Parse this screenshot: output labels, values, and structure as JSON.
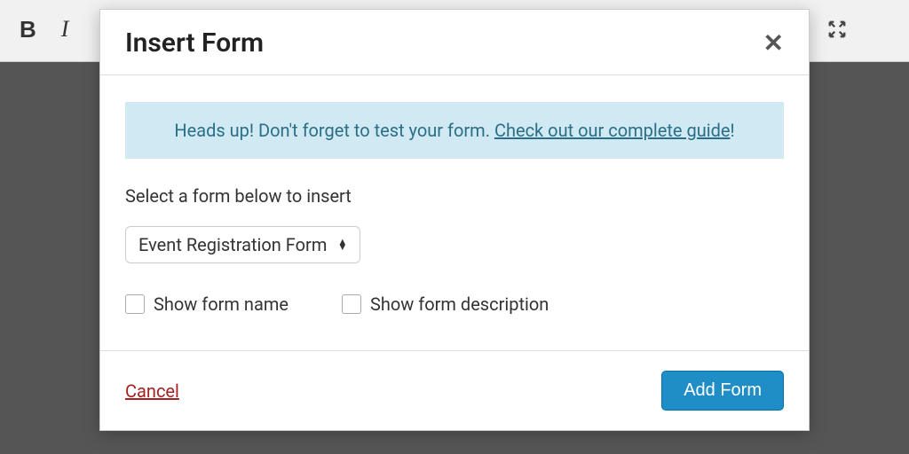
{
  "toolbar": {
    "bold": "B",
    "italic": "I"
  },
  "modal": {
    "title": "Insert Form",
    "close": "✕",
    "notice": {
      "prefix": "Heads up! Don't forget to test your form. ",
      "link": "Check out our complete guide",
      "suffix": "!"
    },
    "select_label": "Select a form below to insert",
    "selected_form": "Event Registration Form",
    "checkbox_name": "Show form name",
    "checkbox_desc": "Show form description",
    "cancel": "Cancel",
    "add": "Add Form"
  }
}
